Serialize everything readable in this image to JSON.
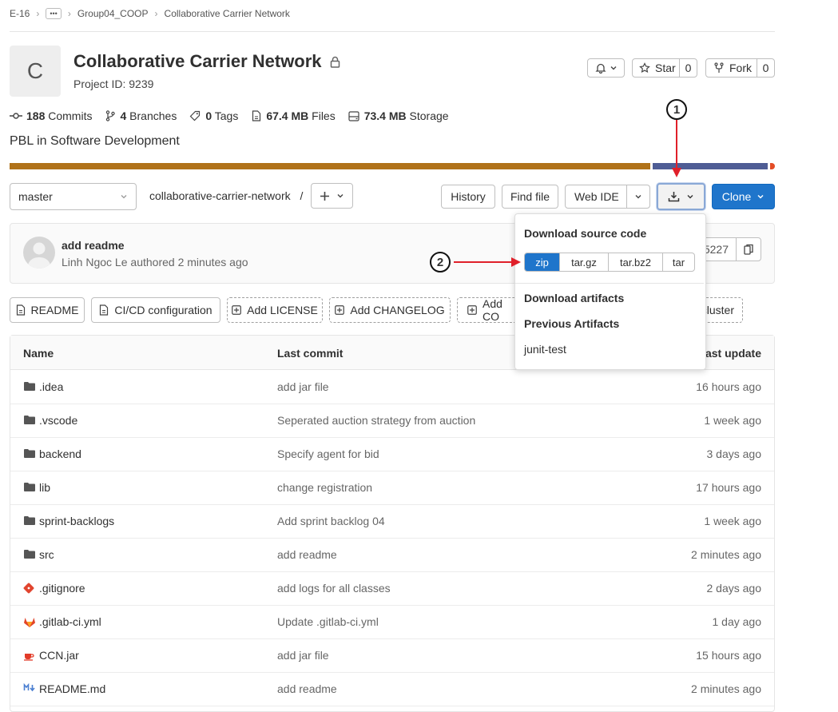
{
  "breadcrumb": {
    "root": "E-16",
    "more": "•••",
    "group": "Group04_COOP",
    "project": "Collaborative Carrier Network"
  },
  "project": {
    "avatar_letter": "C",
    "title": "Collaborative Carrier Network",
    "id_label": "Project ID: 9239",
    "description": "PBL in Software Development"
  },
  "actions": {
    "star_label": "Star",
    "star_count": "0",
    "fork_label": "Fork",
    "fork_count": "0"
  },
  "stats": {
    "commits_count": "188",
    "commits_label": "Commits",
    "branches_count": "4",
    "branches_label": "Branches",
    "tags_count": "0",
    "tags_label": "Tags",
    "files_size": "67.4 MB",
    "files_label": "Files",
    "storage_size": "73.4 MB",
    "storage_label": "Storage"
  },
  "language_bar": {
    "colors": [
      "#b07219",
      "#4f5d95",
      "#e34c26"
    ],
    "fractions": [
      0.842,
      0.152,
      0.006
    ]
  },
  "toolbar": {
    "branch": "master",
    "path": "collaborative-carrier-network",
    "path_sep": "/",
    "history": "History",
    "find_file": "Find file",
    "web_ide": "Web IDE",
    "clone": "Clone"
  },
  "last_commit": {
    "message": "add readme",
    "author": "Linh Ngoc Le",
    "authored": "authored",
    "time": "2 minutes ago",
    "sha_fragment": "5227"
  },
  "quick_buttons": [
    "README",
    "CI/CD configuration",
    "Add LICENSE",
    "Add CHANGELOG",
    "Add CO",
    "cluster"
  ],
  "table": {
    "headers": {
      "name": "Name",
      "last_commit": "Last commit",
      "last_update": "ast update"
    },
    "rows": [
      {
        "name": ".idea",
        "icon": "folder-icon",
        "commit": "add jar file",
        "updated": "16 hours ago"
      },
      {
        "name": ".vscode",
        "icon": "folder-icon",
        "commit": "Seperated auction strategy from auction",
        "updated": "1 week ago"
      },
      {
        "name": "backend",
        "icon": "folder-icon",
        "commit": "Specify agent for bid",
        "updated": "3 days ago"
      },
      {
        "name": "lib",
        "icon": "folder-icon",
        "commit": "change registration",
        "updated": "17 hours ago"
      },
      {
        "name": "sprint-backlogs",
        "icon": "folder-icon",
        "commit": "Add sprint backlog 04",
        "updated": "1 week ago"
      },
      {
        "name": "src",
        "icon": "folder-icon",
        "commit": "add readme",
        "updated": "2 minutes ago"
      },
      {
        "name": ".gitignore",
        "icon": "git-icon",
        "commit": "add logs for all classes",
        "updated": "2 days ago"
      },
      {
        "name": ".gitlab-ci.yml",
        "icon": "gitlab-icon",
        "commit": "Update .gitlab-ci.yml",
        "updated": "1 day ago"
      },
      {
        "name": "CCN.jar",
        "icon": "java-icon",
        "commit": "add jar file",
        "updated": "15 hours ago"
      },
      {
        "name": "README.md",
        "icon": "markdown-icon",
        "commit": "add readme",
        "updated": "2 minutes ago"
      }
    ]
  },
  "dropdown": {
    "source_title": "Download source code",
    "formats": [
      "zip",
      "tar.gz",
      "tar.bz2",
      "tar"
    ],
    "artifacts_title": "Download artifacts",
    "previous_title": "Previous Artifacts",
    "artifact_item": "junit-test"
  },
  "annotations": {
    "step1": "1",
    "step2": "2",
    "arrow_color": "#e0202a"
  }
}
